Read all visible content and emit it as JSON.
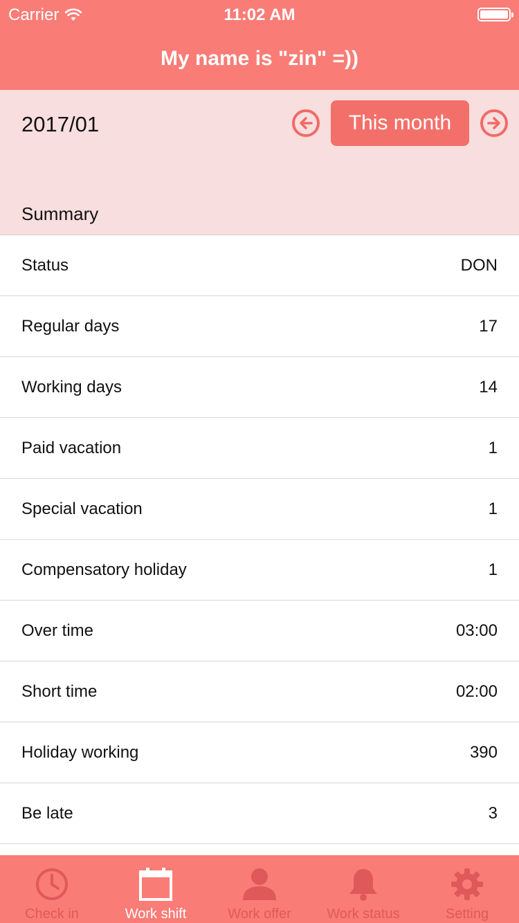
{
  "status_bar": {
    "carrier": "Carrier",
    "time": "11:02 AM"
  },
  "nav": {
    "title": "My name is \"zin\" =))"
  },
  "header": {
    "month": "2017/01",
    "this_month_label": "This month",
    "section_title": "Summary"
  },
  "rows": [
    {
      "label": "Status",
      "value": "DON"
    },
    {
      "label": "Regular days",
      "value": "17"
    },
    {
      "label": "Working days",
      "value": "14"
    },
    {
      "label": "Paid vacation",
      "value": "1"
    },
    {
      "label": "Special vacation",
      "value": "1"
    },
    {
      "label": "Compensatory holiday",
      "value": "1"
    },
    {
      "label": "Over time",
      "value": "03:00"
    },
    {
      "label": "Short time",
      "value": "02:00"
    },
    {
      "label": "Holiday working",
      "value": "390"
    },
    {
      "label": "Be late",
      "value": "3"
    }
  ],
  "tabs": [
    {
      "label": "Check in",
      "icon": "clock-icon",
      "active": false
    },
    {
      "label": "Work shift",
      "icon": "calendar-icon",
      "active": true
    },
    {
      "label": "Work offer",
      "icon": "person-icon",
      "active": false
    },
    {
      "label": "Work status",
      "icon": "bell-icon",
      "active": false
    },
    {
      "label": "Setting",
      "icon": "gear-icon",
      "active": false
    }
  ],
  "colors": {
    "primary": "#f97c76",
    "header_bg": "#f8dede",
    "button": "#f3706a",
    "tab_inactive": "#e0595a",
    "tab_active": "#ffffff"
  }
}
